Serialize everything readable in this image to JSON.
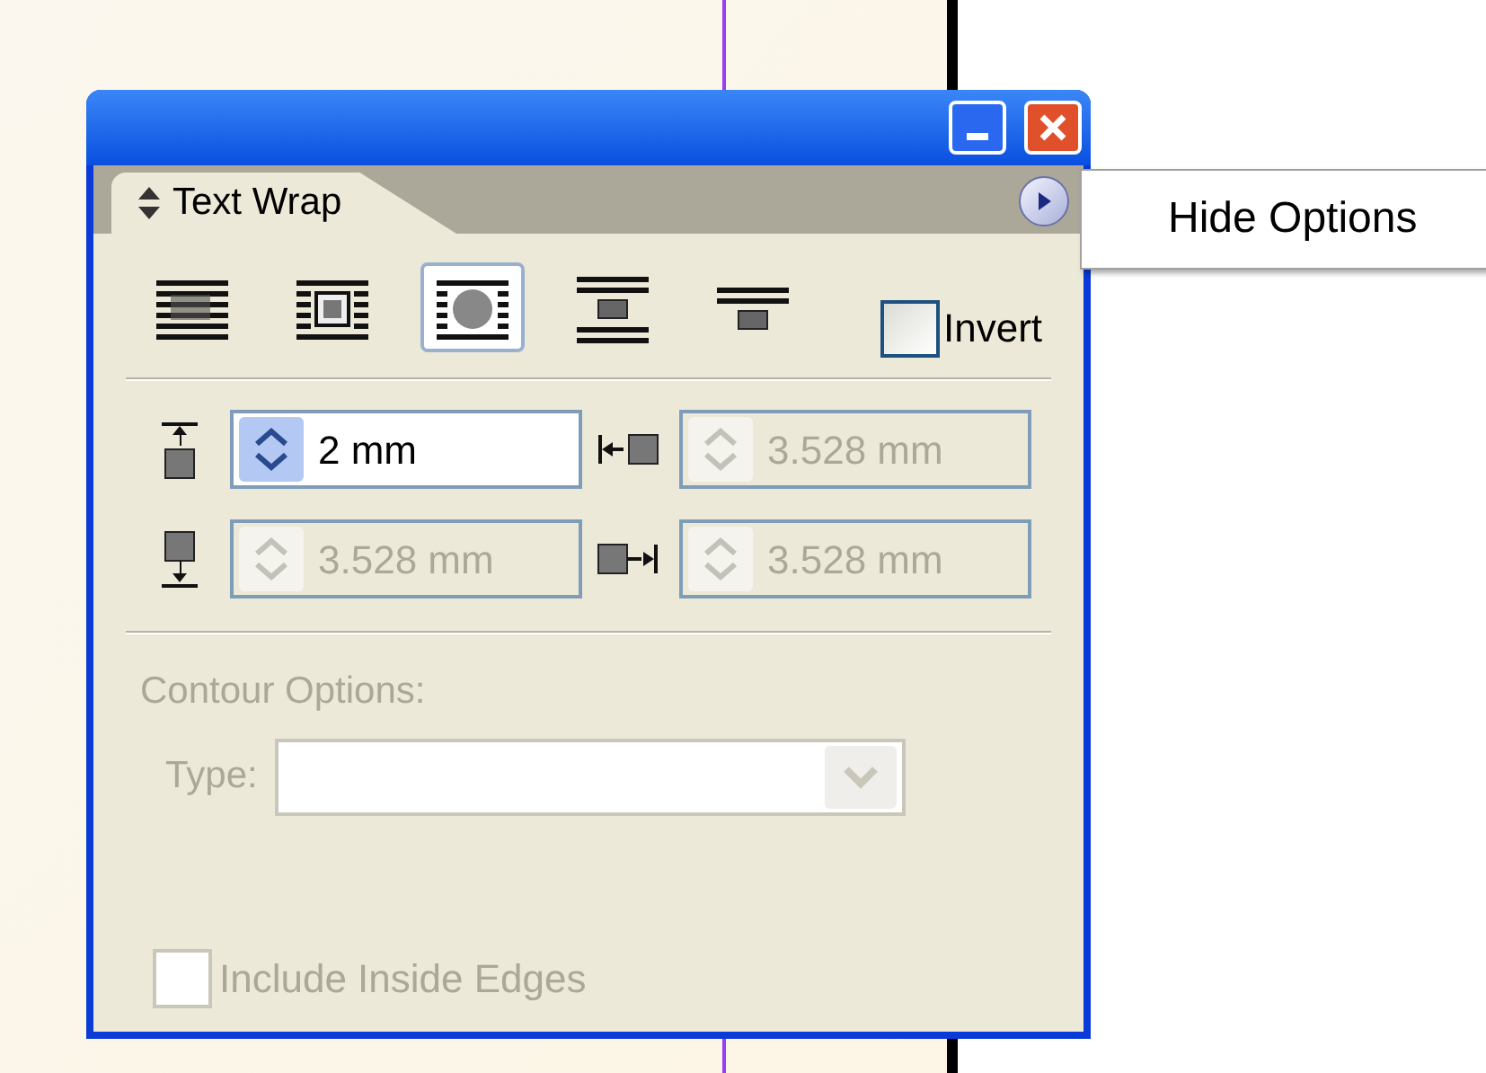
{
  "panel": {
    "tab": {
      "label": "Text Wrap",
      "selected": true
    },
    "wrap_options": [
      {
        "kind": "none",
        "selected": false
      },
      {
        "kind": "bounding-box",
        "selected": false
      },
      {
        "kind": "shape",
        "selected": true
      },
      {
        "kind": "jump",
        "selected": false
      },
      {
        "kind": "next-column",
        "selected": false
      }
    ],
    "invert": {
      "label": "Invert",
      "checked": false
    },
    "offsets": [
      {
        "kind": "top",
        "value": "2 mm",
        "disabled": false
      },
      {
        "kind": "left",
        "value": "3.528 mm",
        "disabled": true
      },
      {
        "kind": "bottom",
        "value": "3.528 mm",
        "disabled": true
      },
      {
        "kind": "right",
        "value": "3.528 mm",
        "disabled": true
      }
    ],
    "contour_options": {
      "label": "Contour Options:",
      "type_label": "Type:",
      "disabled": true
    },
    "include_inside_edges": {
      "label": "Include Inside Edges",
      "checked": false,
      "disabled": true
    }
  },
  "menu": {
    "items": [
      "Hide Options"
    ]
  }
}
